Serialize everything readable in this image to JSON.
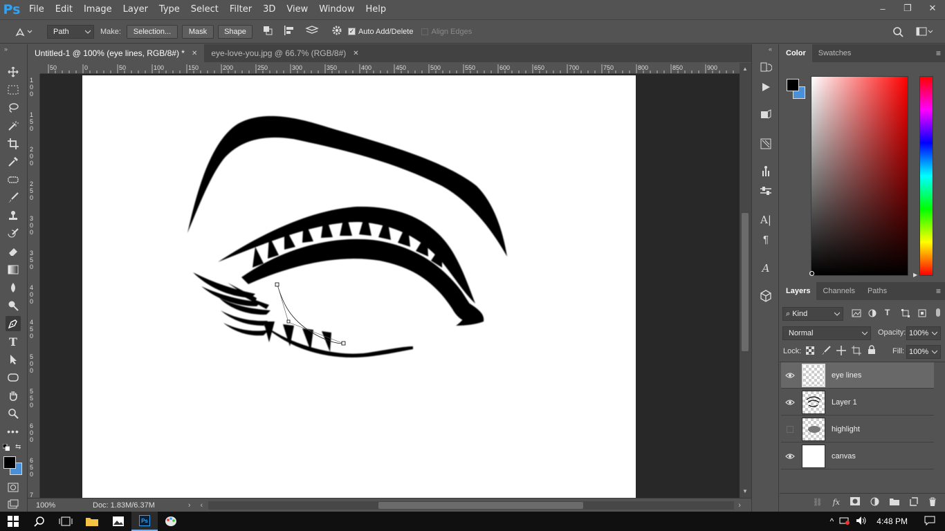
{
  "app": {
    "logo": "Ps"
  },
  "menu": [
    "File",
    "Edit",
    "Image",
    "Layer",
    "Type",
    "Select",
    "Filter",
    "3D",
    "View",
    "Window",
    "Help"
  ],
  "window_controls": {
    "minimize": "–",
    "restore": "❐",
    "close": "✕"
  },
  "options": {
    "tool_mode": "Path",
    "make_label": "Make:",
    "selection_btn": "Selection...",
    "mask_btn": "Mask",
    "shape_btn": "Shape",
    "auto_add_delete": "Auto Add/Delete",
    "align_edges": "Align Edges"
  },
  "tabs": [
    {
      "label": "Untitled-1 @ 100% (eye lines, RGB/8#) *",
      "active": true
    },
    {
      "label": "eye-love-you.jpg @ 66.7% (RGB/8#)",
      "active": false
    }
  ],
  "rulers": {
    "h": [
      "50",
      "0",
      "50",
      "100",
      "150",
      "200",
      "250",
      "300",
      "350",
      "400",
      "450",
      "500",
      "550",
      "600",
      "650",
      "700",
      "750",
      "800",
      "850",
      "900"
    ],
    "v": [
      "1 0 0",
      "1 5 0",
      "2 0 0",
      "2 5 0",
      "3 0 0",
      "3 5 0",
      "4 0 0",
      "4 5 0",
      "5 0 0",
      "5 5 0",
      "6 0 0",
      "6 5 0",
      "7"
    ]
  },
  "status": {
    "zoom": "100%",
    "doc": "Doc: 1.83M/6.37M"
  },
  "color_panel": {
    "tabs": [
      "Color",
      "Swatches"
    ],
    "fg": "#000000",
    "bg": "#4a90d9"
  },
  "layers_panel": {
    "tabs": [
      "Layers",
      "Channels",
      "Paths"
    ],
    "filter": "Kind",
    "blend_mode": "Normal",
    "opacity_label": "Opacity:",
    "opacity": "100%",
    "lock_label": "Lock:",
    "fill_label": "Fill:",
    "fill": "100%",
    "layers": [
      {
        "name": "eye lines",
        "visible": true,
        "selected": true
      },
      {
        "name": "Layer 1",
        "visible": true,
        "selected": false
      },
      {
        "name": "highlight",
        "visible": false,
        "selected": false
      },
      {
        "name": "canvas",
        "visible": true,
        "selected": false
      }
    ]
  },
  "taskbar": {
    "time": "4:48 PM"
  }
}
